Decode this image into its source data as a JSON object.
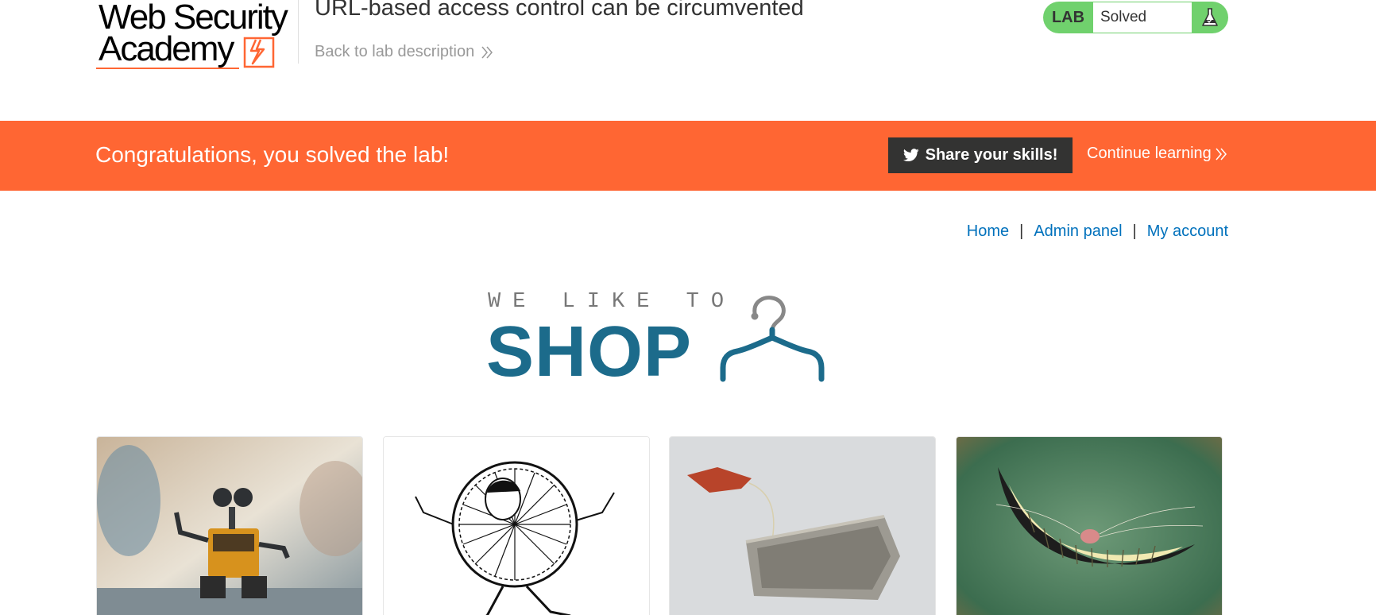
{
  "header": {
    "logo": {
      "line1": "Web Security",
      "line2": "Academy"
    },
    "lab_title": "URL-based access control can be circumvented",
    "back_link": "Back to lab description",
    "status": {
      "label": "LAB",
      "value": "Solved"
    }
  },
  "banner": {
    "message": "Congratulations, you solved the lab!",
    "share_label": "Share your skills!",
    "continue_label": "Continue learning"
  },
  "nav": {
    "items": [
      {
        "label": "Home"
      },
      {
        "label": "Admin panel"
      },
      {
        "label": "My account"
      }
    ],
    "separator": "|"
  },
  "shop": {
    "tagline": "WE LIKE TO",
    "word": "SHOP"
  },
  "products": [
    {
      "image": "toy-robot-photo"
    },
    {
      "image": "sunburst-man-illustration"
    },
    {
      "image": "tea-bag-photo"
    },
    {
      "image": "grinning-cat-smile"
    }
  ],
  "colors": {
    "accent": "#ff6633",
    "lab_solved": "#70d16d",
    "link": "#0071bc",
    "shop_blue": "#1c6b8b",
    "share_bg": "#333332"
  }
}
